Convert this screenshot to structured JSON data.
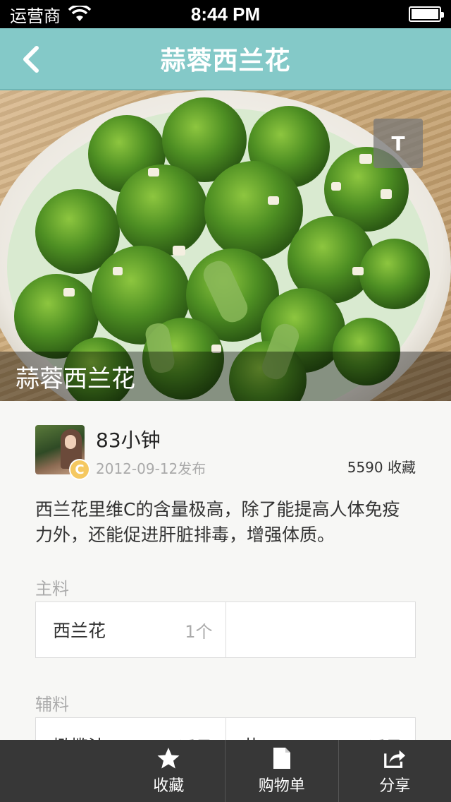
{
  "status_bar": {
    "carrier": "运营商",
    "time": "8:44 PM"
  },
  "nav": {
    "title": "蒜蓉西兰花"
  },
  "hero": {
    "caption": "蒜蓉西兰花",
    "t_button_label": "T"
  },
  "author": {
    "name": "83小钟",
    "badge": "C",
    "publish_date": "2012-09-12发布",
    "favorites": "5590 收藏"
  },
  "description": "西兰花里维C的含量极高，除了能提高人体免疫力外，还能促进肝脏排毒，增强体质。",
  "main_ingredients": {
    "label": "主料",
    "items": [
      {
        "name": "西兰花",
        "amount": "1个"
      },
      {
        "name": "",
        "amount": ""
      }
    ]
  },
  "secondary_ingredients": {
    "label": "辅料",
    "items": [
      {
        "name": "橄榄油",
        "amount": "适量"
      },
      {
        "name": "盐",
        "amount": "适量"
      }
    ]
  },
  "toolbar": {
    "favorite_label": "收藏",
    "shopping_list_label": "购物单",
    "share_label": "分享"
  },
  "colors": {
    "nav_bar": "#84c9c8",
    "toolbar": "#373737",
    "badge": "#f5c860"
  }
}
